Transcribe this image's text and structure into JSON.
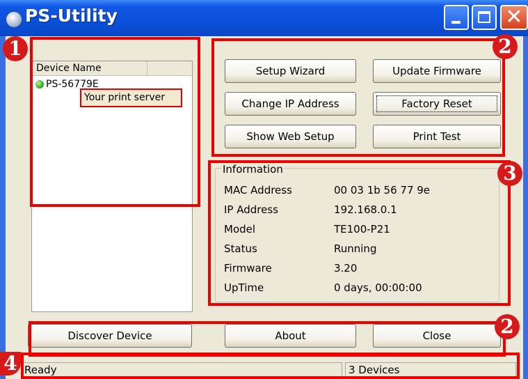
{
  "window": {
    "title": "PS-Utility",
    "icons": {
      "app": "app-globe-icon",
      "minimize": "minimize-icon",
      "maximize": "maximize-icon",
      "close": "close-icon"
    }
  },
  "device_list": {
    "columns": [
      "Device Name",
      ""
    ],
    "items": [
      {
        "name": "PS-56779E",
        "status_icon": "green-status-dot-icon"
      }
    ]
  },
  "annotation": {
    "tooltip": "Your print server",
    "markers": [
      "1",
      "2",
      "3",
      "2",
      "4"
    ]
  },
  "buttons": {
    "setup_wizard": "Setup Wizard",
    "update_firmware": "Update Firmware",
    "change_ip": "Change IP Address",
    "factory_reset": "Factory Reset",
    "show_web_setup": "Show Web Setup",
    "print_test": "Print Test",
    "discover_device": "Discover Device",
    "about": "About",
    "close": "Close"
  },
  "information": {
    "title": "Information",
    "rows": [
      {
        "label": "MAC Address",
        "value": "00 03 1b 56 77 9e"
      },
      {
        "label": "IP Address",
        "value": "192.168.0.1"
      },
      {
        "label": "Model",
        "value": "TE100-P21"
      },
      {
        "label": "Status",
        "value": "Running"
      },
      {
        "label": "Firmware",
        "value": "3.20"
      },
      {
        "label": "UpTime",
        "value": "0 days, 00:00:00"
      }
    ]
  },
  "status_bar": {
    "status": "Ready",
    "device_count": "3 Devices"
  },
  "colors": {
    "titlebar": "#0a4fd8",
    "dialog": "#ece9d8",
    "annotation": "#ee0000"
  }
}
